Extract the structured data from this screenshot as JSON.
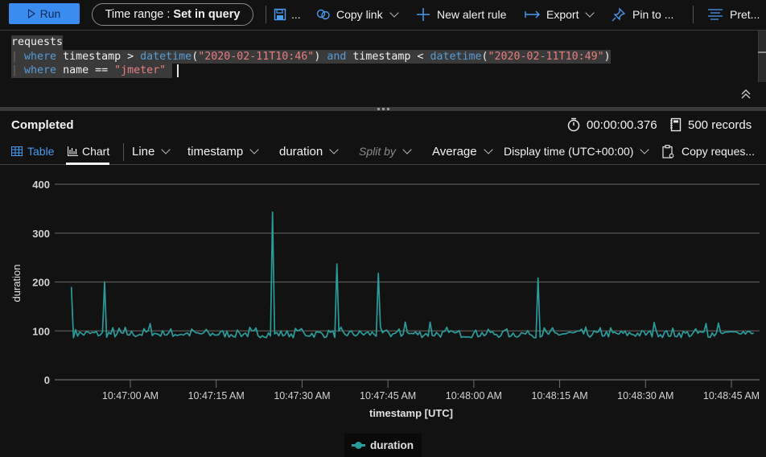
{
  "toolbar": {
    "run_label": "Run",
    "time_range_prefix": "Time range :",
    "time_range_value": "Set in query",
    "save_label": "...",
    "copy_link_label": "Copy link",
    "new_alert_rule_label": "New alert rule",
    "export_label": "Export",
    "pin_label": "Pin to ...",
    "prettify_label": "Pret..."
  },
  "editor": {
    "lines": [
      {
        "table": "requests"
      },
      {
        "pipe": "|",
        "kw1": "where",
        "t1": " timestamp > ",
        "fn1": "datetime",
        "p1": "(",
        "s1": "\"2020-02-11T10:46\"",
        "p2": ") ",
        "kw2": "and",
        "t2": " timestamp < ",
        "fn2": "datetime",
        "p3": "(",
        "s2": "\"2020-02-11T10:49\"",
        "p4": ")"
      },
      {
        "pipe": "|",
        "kw1": "where",
        "t1": " name == ",
        "s1": "\"jmeter\""
      }
    ]
  },
  "results": {
    "status": "Completed",
    "duration": "00:00:00.376",
    "records": "500 records",
    "tabs": [
      {
        "label": "Table",
        "active": false
      },
      {
        "label": "Chart",
        "active": true
      }
    ],
    "chart_type": "Line",
    "x_column": "timestamp",
    "y_column": "duration",
    "split_by": "Split by",
    "aggregation": "Average",
    "display_time": "Display time (UTC+00:00)",
    "copy_request": "Copy reques..."
  },
  "colors": {
    "accent": "#3b8cf0",
    "series": "#2a9c9c",
    "keyword": "#569cd6",
    "string": "#e87e7e"
  },
  "chart_data": {
    "type": "line",
    "title": "",
    "xlabel": "timestamp [UTC]",
    "ylabel": "duration",
    "ylim": [
      0,
      400
    ],
    "yticks": [
      0,
      100,
      200,
      300,
      400
    ],
    "xlim_seconds": [
      45,
      170
    ],
    "xtick_labels": [
      "10:47:00 AM",
      "10:47:15 AM",
      "10:47:30 AM",
      "10:47:45 AM",
      "10:48:00 AM",
      "10:48:15 AM",
      "10:48:30 AM",
      "10:48:45 AM"
    ],
    "xtick_seconds": [
      60,
      75,
      90,
      105,
      120,
      135,
      150,
      165
    ],
    "x_unit": "seconds after 10:46:00 UTC",
    "grid": true,
    "legend": {
      "position": "bottom-center",
      "entries": [
        "duration"
      ]
    },
    "series": [
      {
        "name": "duration",
        "start_second": 49.7,
        "end_second": 168.9,
        "first_value": 190,
        "baseline_value": 95,
        "baseline_range": [
          85,
          115
        ],
        "spikes": [
          {
            "second": 55.6,
            "value": 200
          },
          {
            "second": 84.9,
            "value": 343
          },
          {
            "second": 95.9,
            "value": 237
          },
          {
            "second": 103.5,
            "value": 218
          },
          {
            "second": 131.4,
            "value": 208
          },
          {
            "second": 63.3,
            "value": 115
          },
          {
            "second": 108.0,
            "value": 118
          },
          {
            "second": 112.2,
            "value": 118
          },
          {
            "second": 151.5,
            "value": 117
          },
          {
            "second": 160.6,
            "value": 115
          },
          {
            "second": 162.9,
            "value": 116
          }
        ],
        "point_count": 330,
        "seed": 7
      }
    ]
  }
}
